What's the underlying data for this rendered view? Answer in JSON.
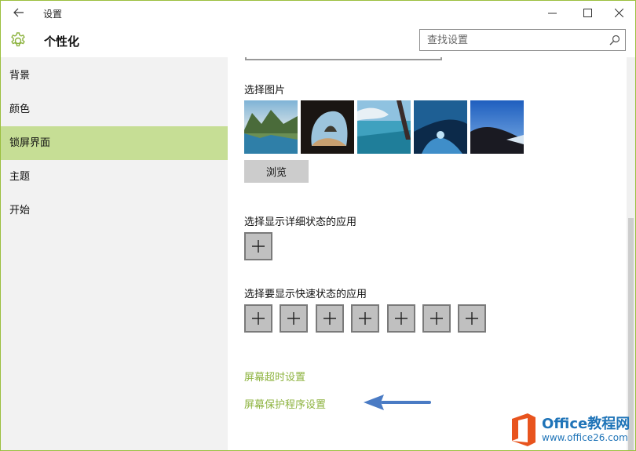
{
  "window": {
    "title": "设置",
    "back_icon": "back-arrow-icon",
    "minimize_glyph": "—",
    "maximize_glyph": "☐",
    "close_glyph": "✕"
  },
  "header": {
    "title": "个性化",
    "icon": "gear-icon",
    "accent_color": "#8db33f",
    "search": {
      "placeholder": "查找设置",
      "value": ""
    }
  },
  "sidebar": {
    "selected_color": "#c6de95",
    "items": [
      {
        "label": "背景",
        "selected": false
      },
      {
        "label": "颜色",
        "selected": false
      },
      {
        "label": "锁屏界面",
        "selected": true
      },
      {
        "label": "主题",
        "selected": false
      },
      {
        "label": "开始",
        "selected": false
      }
    ]
  },
  "content": {
    "choose_picture_label": "选择图片",
    "browse_label": "浏览",
    "detailed_status_label": "选择显示详细状态的应用",
    "quick_status_label": "选择要显示快速状态的应用",
    "plus_glyph": "+",
    "quick_status_slot_count": 7,
    "links": {
      "screen_timeout": "屏幕超时设置",
      "screen_saver": "屏幕保护程序设置"
    },
    "link_color": "#8db33f",
    "annotation_arrow_color": "#4a7bc4"
  },
  "watermark": {
    "brand": "Office教程网",
    "url": "www.office26.com",
    "logo_color": "#e8541e"
  }
}
